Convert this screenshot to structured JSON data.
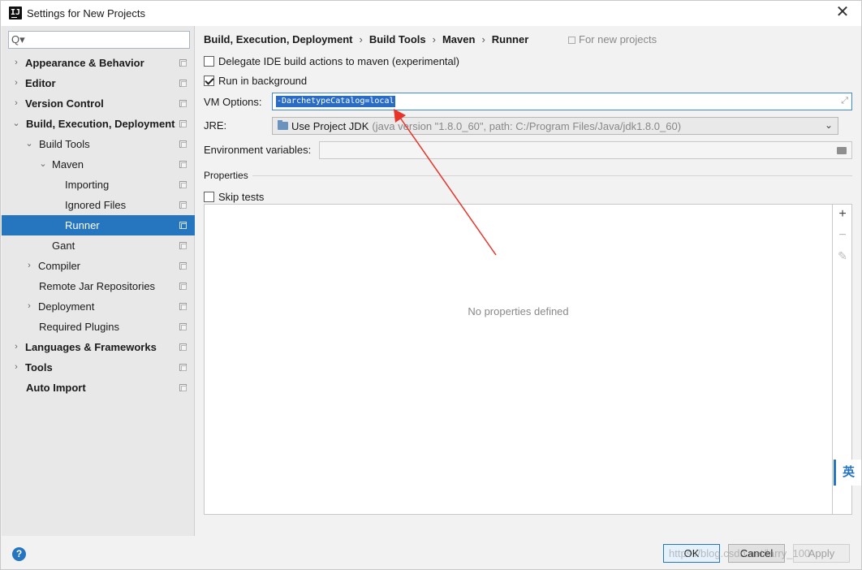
{
  "window": {
    "title": "Settings for New Projects",
    "app_icon_text": "IJ",
    "close_glyph": "✕"
  },
  "sidebar": {
    "search_icon": "Q▾",
    "search_placeholder": "",
    "items": [
      {
        "label": "Appearance & Behavior",
        "arrow": "›"
      },
      {
        "label": "Editor",
        "arrow": "›"
      },
      {
        "label": "Version Control",
        "arrow": "›"
      },
      {
        "label": "Build, Execution, Deployment",
        "arrow": "⌄"
      },
      {
        "label": "Build Tools",
        "arrow": "⌄"
      },
      {
        "label": "Maven",
        "arrow": "⌄"
      },
      {
        "label": "Importing",
        "arrow": ""
      },
      {
        "label": "Ignored Files",
        "arrow": ""
      },
      {
        "label": "Runner",
        "arrow": ""
      },
      {
        "label": "Gant",
        "arrow": ""
      },
      {
        "label": "Compiler",
        "arrow": "›"
      },
      {
        "label": "Remote Jar Repositories",
        "arrow": ""
      },
      {
        "label": "Deployment",
        "arrow": "›"
      },
      {
        "label": "Required Plugins",
        "arrow": ""
      },
      {
        "label": "Languages & Frameworks",
        "arrow": "›"
      },
      {
        "label": "Tools",
        "arrow": "›"
      },
      {
        "label": "Auto Import",
        "arrow": ""
      }
    ],
    "help_label": "?"
  },
  "main": {
    "breadcrumb": [
      "Build, Execution, Deployment",
      "Build Tools",
      "Maven",
      "Runner"
    ],
    "breadcrumb_sep": "›",
    "hint": "For new projects",
    "delegate_label": "Delegate IDE build actions to maven (experimental)",
    "delegate_checked": false,
    "background_label": "Run in background",
    "background_checked": true,
    "vm_label": "VM Options:",
    "vm_value": "-DarchetypeCatalog=local",
    "vm_expand_icon": "⤢",
    "jre_label": "JRE:",
    "jre_value": "Use Project JDK",
    "jre_detail": "(java version \"1.8.0_60\", path: C:/Program Files/Java/jdk1.8.0_60)",
    "jre_chevron": "⌄",
    "env_label": "Environment variables:",
    "env_value": "",
    "properties_label": "Properties",
    "skip_tests_label": "Skip tests",
    "skip_tests_checked": false,
    "empty_text": "No properties defined",
    "tool_add": "+",
    "tool_remove": "−",
    "tool_edit": "✎"
  },
  "footer": {
    "ok": "OK",
    "cancel": "Cancel",
    "apply": "Apply"
  },
  "ime_indicator": "英",
  "watermark": "https://blog.csdn.net/larry_100",
  "annotation_color": "#e8332a",
  "accent_color": "#2675bf"
}
